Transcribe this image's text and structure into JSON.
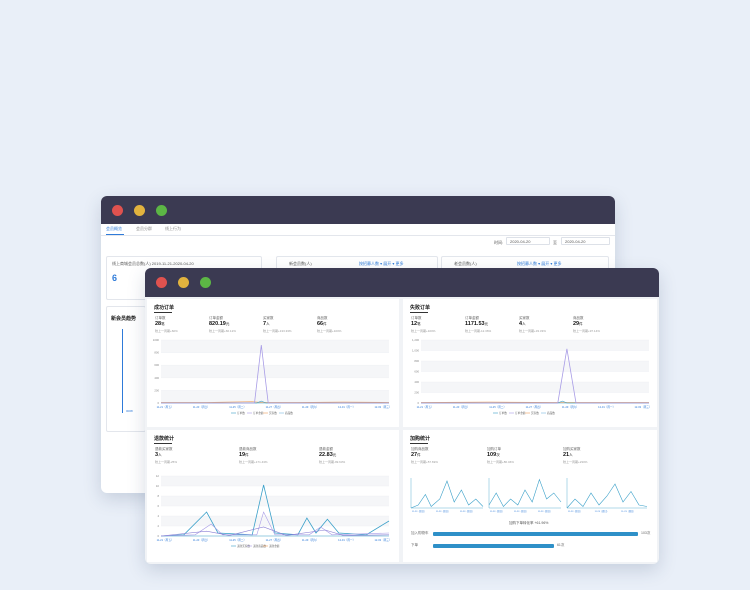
{
  "colors": {
    "titlebar": "#3b3a52",
    "accent": "#2f7bd9",
    "line_main": "#3aa0c9",
    "line_purple": "#a89ce6",
    "line_orange": "#f0a05a"
  },
  "back_window": {
    "tabs": [
      "会员概览",
      "会员分群",
      "线上行为"
    ],
    "date_label": "时间:",
    "date_start": "2020-04-20",
    "date_to": "至",
    "date_end": "2020-04-20",
    "card1": {
      "label": "线上商城会员总数(人)  2019-11-21-2020-04-20",
      "value": "6"
    },
    "card2": {
      "label": "新会员数(人)",
      "right": "按招募人数 ▾  展开 ▾ 更多"
    },
    "card3": {
      "label": "老会员数(人)",
      "right": "按招募人数 ▾  展开 ▾ 更多"
    },
    "trend_title": "新会员趋势",
    "trend_tick": "0008"
  },
  "panels": {
    "success": {
      "title": "成功订单",
      "metrics": [
        {
          "label": "订单数",
          "value": "28",
          "unit": "笔",
          "sub": "较上一周期+60%"
        },
        {
          "label": "订单金额",
          "value": "820.19",
          "unit": "元",
          "sub": "较上一周期+66.12%"
        },
        {
          "label": "买家数",
          "value": "7",
          "unit": "人",
          "sub": "较上一周期+133.33%"
        },
        {
          "label": "商品数",
          "value": "66",
          "unit": "件",
          "sub": "较上一周期+100%"
        }
      ],
      "y_ticks": [
        "1000",
        "800",
        "600",
        "400",
        "200",
        "0"
      ],
      "x_ticks": [
        "11-21（周五）",
        "11-23（周日）",
        "11-25（周二）",
        "11-27（周四）",
        "11-29（周六）",
        "12-01（周一）",
        "12-03（周三）"
      ],
      "legend": [
        "订单数",
        "订单金额",
        "买家数",
        "商品数"
      ]
    },
    "fail": {
      "title": "失败订单",
      "metrics": [
        {
          "label": "订单数",
          "value": "12",
          "unit": "笔",
          "sub": "较上一周期+100%"
        },
        {
          "label": "订单金额",
          "value": "1171.53",
          "unit": "元",
          "sub": "较上一周期-12.36%"
        },
        {
          "label": "买家数",
          "value": "4",
          "unit": "人",
          "sub": "较上一周期+33.33%"
        },
        {
          "label": "商品数",
          "value": "29",
          "unit": "件",
          "sub": "较上一周期+97.14%"
        }
      ],
      "y_ticks": [
        "1,200",
        "1,000",
        "800",
        "600",
        "400",
        "200",
        "0"
      ],
      "x_ticks": [
        "11-21（周五）",
        "11-23（周日）",
        "11-25（周二）",
        "11-27（周四）",
        "11-29（周六）",
        "12-01（周一）",
        "12-03（周三）"
      ],
      "legend": [
        "订单数",
        "订单金额",
        "买家数",
        "商品数"
      ]
    },
    "refund": {
      "title": "退款统计",
      "metrics": [
        {
          "label": "退款买家数",
          "value": "3",
          "unit": "人",
          "sub": "较上一周期-25%"
        },
        {
          "label": "退款商品数",
          "value": "19",
          "unit": "件",
          "sub": "较上一周期+171.43%"
        },
        {
          "label": "退款金额",
          "value": "22.83",
          "unit": "元",
          "sub": "较上一周期-99.63%"
        }
      ],
      "y_ticks": [
        "12",
        "10",
        "8",
        "6",
        "4",
        "2",
        "0"
      ],
      "x_ticks": [
        "11-21（周五）",
        "11-23（周日）",
        "11-25（周二）",
        "11-27（周四）",
        "11-29（周六）",
        "12-01（周一）",
        "12-03（周三）"
      ],
      "legend": [
        "退款买家数",
        "退款商品数",
        "退款金额"
      ]
    },
    "cart": {
      "title": "加购统计",
      "metrics": [
        {
          "label": "加购商品数",
          "value": "27",
          "unit": "件",
          "sub": "较上一周期+57.69%"
        },
        {
          "label": "加购订单",
          "value": "109",
          "unit": "次",
          "sub": "较上一周期+86.46%"
        },
        {
          "label": "加购买家数",
          "value": "21",
          "unit": "人",
          "sub": "较上一周期+230%"
        }
      ],
      "mini_tick": "11-23（周日）",
      "funnel_title": "加购下单转化率 +61.96%",
      "funnel": [
        {
          "label": "加入购物车",
          "value": "103次",
          "fraction": 1.0
        },
        {
          "label": "下单",
          "value": "61次",
          "fraction": 0.59
        }
      ]
    }
  }
}
